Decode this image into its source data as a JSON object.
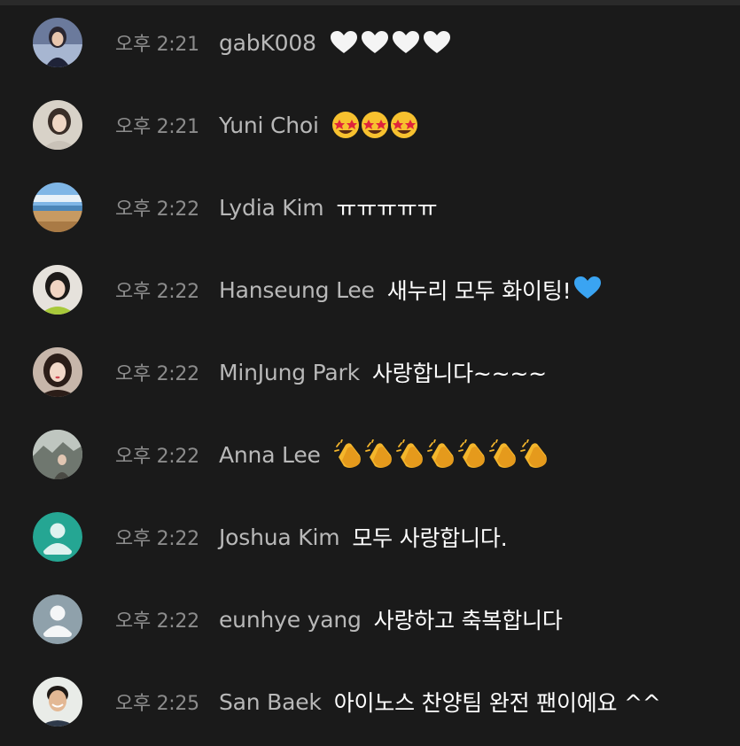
{
  "messages": [
    {
      "time": "오후 2:21",
      "author": "gabK008",
      "text": "",
      "emoji": "heart-white",
      "emoji_count": 4,
      "avatar": "photo-woman-1"
    },
    {
      "time": "오후 2:21",
      "author": "Yuni Choi",
      "text": "",
      "emoji": "star-struck",
      "emoji_count": 3,
      "avatar": "photo-woman-2"
    },
    {
      "time": "오후 2:22",
      "author": "Lydia Kim",
      "text": "ㅠㅠㅠㅠㅠ",
      "emoji": "",
      "emoji_count": 0,
      "avatar": "photo-beach"
    },
    {
      "time": "오후 2:22",
      "author": "Hanseung Lee",
      "text": "새누리 모두 화이팅!",
      "emoji": "heart-blue",
      "emoji_count": 1,
      "avatar": "photo-woman-3"
    },
    {
      "time": "오후 2:22",
      "author": "MinJung Park",
      "text": "사랑합니다~~~~",
      "emoji": "",
      "emoji_count": 0,
      "avatar": "photo-woman-4"
    },
    {
      "time": "오후 2:22",
      "author": "Anna Lee",
      "text": "",
      "emoji": "clapping-hands",
      "emoji_count": 7,
      "avatar": "photo-landscape"
    },
    {
      "time": "오후 2:22",
      "author": "Joshua Kim",
      "text": "모두 사랑합니다.",
      "emoji": "",
      "emoji_count": 0,
      "avatar": "default-teal"
    },
    {
      "time": "오후 2:22",
      "author": "eunhye yang",
      "text": "사랑하고 축복합니다",
      "emoji": "",
      "emoji_count": 0,
      "avatar": "default-gray"
    },
    {
      "time": "오후 2:25",
      "author": "San Baek",
      "text": "아이노스 찬양팀 완전 팬이에요 ^^",
      "emoji": "",
      "emoji_count": 0,
      "avatar": "photo-man-1"
    }
  ],
  "colors": {
    "background": "#1a1a1a",
    "time": "#8c8c8c",
    "author": "#b8b8b8",
    "message": "#ffffff",
    "default_avatar_teal": "#25a693",
    "default_avatar_gray": "#8fa1ab"
  }
}
